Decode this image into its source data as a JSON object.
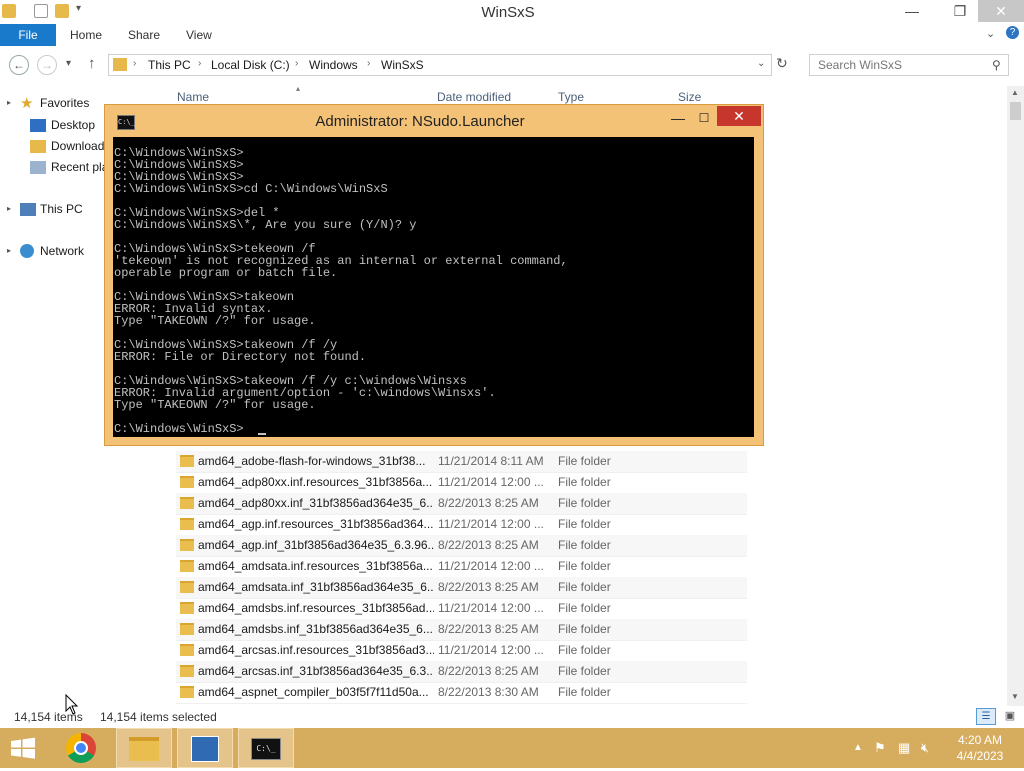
{
  "explorer": {
    "title": "WinSxS",
    "ribbon_tabs": [
      "File",
      "Home",
      "Share",
      "View"
    ],
    "breadcrumb": [
      "This PC",
      "Local Disk (C:)",
      "Windows",
      "WinSxS"
    ],
    "search_placeholder": "Search WinSxS",
    "nav": {
      "favorites": "Favorites",
      "desktop": "Desktop",
      "downloads": "Download",
      "recent": "Recent pla",
      "thispc": "This PC",
      "network": "Network"
    },
    "columns": [
      "Name",
      "Date modified",
      "Type",
      "Size"
    ],
    "files": [
      {
        "name": "amd64_adobe-flash-for-windows_31bf38...",
        "date": "11/21/2014 8:11 AM",
        "type": "File folder"
      },
      {
        "name": "amd64_adp80xx.inf.resources_31bf3856a...",
        "date": "11/21/2014 12:00 ...",
        "type": "File folder"
      },
      {
        "name": "amd64_adp80xx.inf_31bf3856ad364e35_6....",
        "date": "8/22/2013 8:25 AM",
        "type": "File folder"
      },
      {
        "name": "amd64_agp.inf.resources_31bf3856ad364...",
        "date": "11/21/2014 12:00 ...",
        "type": "File folder"
      },
      {
        "name": "amd64_agp.inf_31bf3856ad364e35_6.3.96...",
        "date": "8/22/2013 8:25 AM",
        "type": "File folder"
      },
      {
        "name": "amd64_amdsata.inf.resources_31bf3856a...",
        "date": "11/21/2014 12:00 ...",
        "type": "File folder"
      },
      {
        "name": "amd64_amdsata.inf_31bf3856ad364e35_6....",
        "date": "8/22/2013 8:25 AM",
        "type": "File folder"
      },
      {
        "name": "amd64_amdsbs.inf.resources_31bf3856ad...",
        "date": "11/21/2014 12:00 ...",
        "type": "File folder"
      },
      {
        "name": "amd64_amdsbs.inf_31bf3856ad364e35_6....",
        "date": "8/22/2013 8:25 AM",
        "type": "File folder"
      },
      {
        "name": "amd64_arcsas.inf.resources_31bf3856ad3...",
        "date": "11/21/2014 12:00 ...",
        "type": "File folder"
      },
      {
        "name": "amd64_arcsas.inf_31bf3856ad364e35_6.3....",
        "date": "8/22/2013 8:25 AM",
        "type": "File folder"
      },
      {
        "name": "amd64_aspnet_compiler_b03f5f7f11d50a...",
        "date": "8/22/2013 8:30 AM",
        "type": "File folder"
      }
    ],
    "status_items": "14,154 items",
    "status_selected": "14,154 items selected"
  },
  "console": {
    "title": "Administrator: NSudo.Launcher",
    "icon_text": "C:\\_",
    "lines": [
      "C:\\Windows\\WinSxS>",
      "C:\\Windows\\WinSxS>",
      "C:\\Windows\\WinSxS>",
      "C:\\Windows\\WinSxS>cd C:\\Windows\\WinSxS",
      "",
      "C:\\Windows\\WinSxS>del *",
      "C:\\Windows\\WinSxS\\*, Are you sure (Y/N)? y",
      "",
      "C:\\Windows\\WinSxS>tekeown /f",
      "'tekeown' is not recognized as an internal or external command,",
      "operable program or batch file.",
      "",
      "C:\\Windows\\WinSxS>takeown",
      "ERROR: Invalid syntax.",
      "Type \"TAKEOWN /?\" for usage.",
      "",
      "C:\\Windows\\WinSxS>takeown /f /y",
      "ERROR: File or Directory not found.",
      "",
      "C:\\Windows\\WinSxS>takeown /f /y c:\\windows\\Winsxs",
      "ERROR: Invalid argument/option - 'c:\\windows\\Winsxs'.",
      "Type \"TAKEOWN /?\" for usage.",
      "",
      "C:\\Windows\\WinSxS>"
    ]
  },
  "taskbar": {
    "time": "4:20 AM",
    "date": "4/4/2023"
  },
  "colors": {
    "console_frame": "#f3c277",
    "taskbar": "#d6ac5e",
    "file_tab": "#1979ca",
    "console_close": "#c7362c"
  }
}
